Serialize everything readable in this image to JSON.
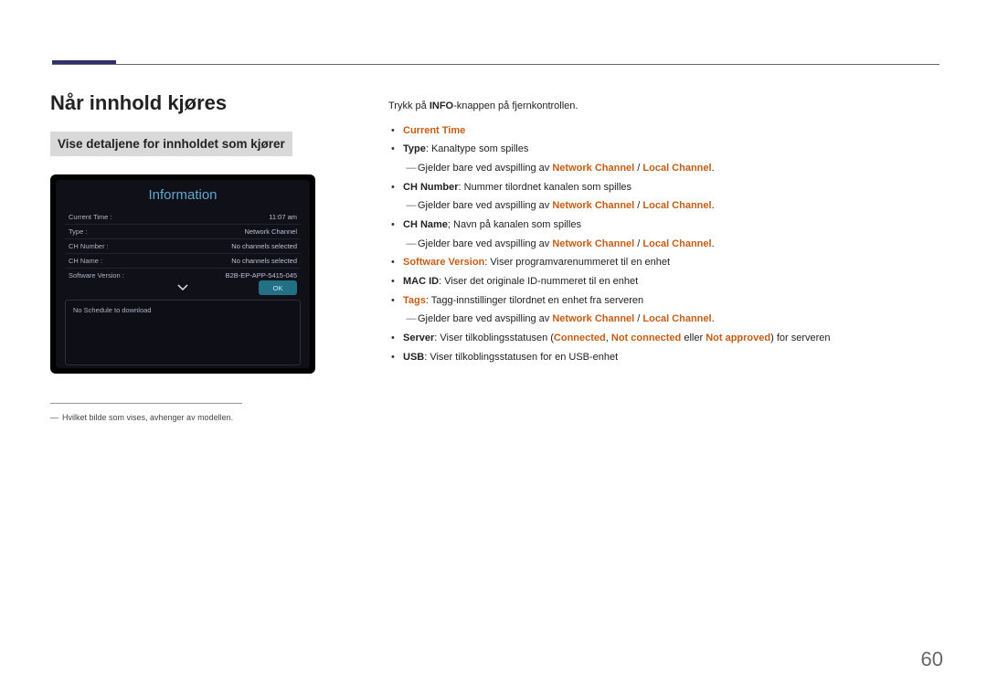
{
  "heading": "Når innhold kjøres",
  "subheading": "Vise detaljene for innholdet som kjører",
  "infoBox": {
    "title": "Information",
    "rows": [
      {
        "label": "Current Time :",
        "value": "11:07 am"
      },
      {
        "label": "Type :",
        "value": "Network Channel"
      },
      {
        "label": "CH Number :",
        "value": "No channels selected"
      },
      {
        "label": "CH Name :",
        "value": "No channels selected"
      },
      {
        "label": "Software Version :",
        "value": "B2B-EP-APP-5415-045"
      }
    ],
    "okLabel": "OK",
    "scheduleText": "No Schedule to download"
  },
  "footnote": "Hvilket bilde som vises, avhenger av modellen.",
  "intro": {
    "pre": "Trykk på ",
    "bold": "INFO",
    "post": "-knappen på fjernkontrollen."
  },
  "bullets": {
    "b1_hl": "Current Time",
    "b2_bold": "Type",
    "b2_txt": ": Kanaltype som spilles",
    "b3_bold": "CH Number",
    "b3_txt": ": Nummer tilordnet kanalen som spilles",
    "b4_bold": "CH Name",
    "b4_txt": "; Navn på kanalen som spilles",
    "b5_hl": "Software Version",
    "b5_txt": ": Viser programvarenummeret til en enhet",
    "b6_bold": "MAC ID",
    "b6_txt": ": Viser det originale ID-nummeret til en enhet",
    "b7_hl": "Tags",
    "b7_txt": ": Tagg-innstillinger tilordnet en enhet fra serveren",
    "b8_bold": "Server",
    "b8_pre": ": Viser tilkoblingsstatusen (",
    "b8_h1": "Connected",
    "b8_c1": ", ",
    "b8_h2": "Not connected",
    "b8_c2": " eller ",
    "b8_h3": "Not approved",
    "b8_post": ") for serveren",
    "b9_bold": "USB",
    "b9_txt": ": Viser tilkoblingsstatusen for en USB-enhet",
    "sub_pre": "Gjelder bare ved avspilling av ",
    "sub_h1": "Network Channel",
    "sub_sep": " / ",
    "sub_h2": "Local Channel",
    "sub_post": "."
  },
  "pageNumber": "60"
}
